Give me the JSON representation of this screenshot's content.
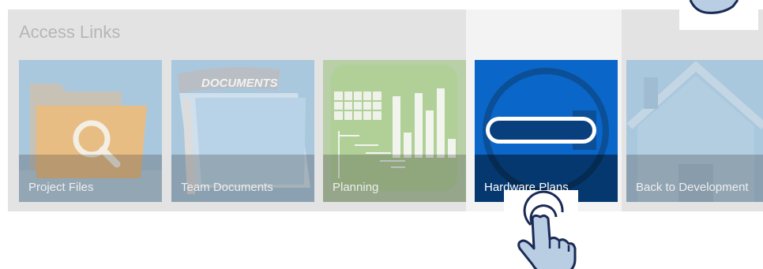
{
  "webpart": {
    "title": "Access Links"
  },
  "tiles": [
    {
      "label": "Project Files",
      "icon": "folder-search-icon",
      "highlighted": false
    },
    {
      "label": "Team Documents",
      "icon": "documents-folder-icon",
      "highlighted": false
    },
    {
      "label": "Planning",
      "icon": "gantt-chart-icon",
      "highlighted": false
    },
    {
      "label": "Hardware Plans",
      "icon": "hardware-minus-icon",
      "highlighted": true
    },
    {
      "label": "Back to Development",
      "icon": "home-icon",
      "highlighted": false
    }
  ],
  "documents_folder_text": "DOCUMENTS",
  "colors": {
    "highlight_tile": "#0a66c8",
    "overlay": "#e3e3e3"
  },
  "cursor": "tap-hand-icon"
}
